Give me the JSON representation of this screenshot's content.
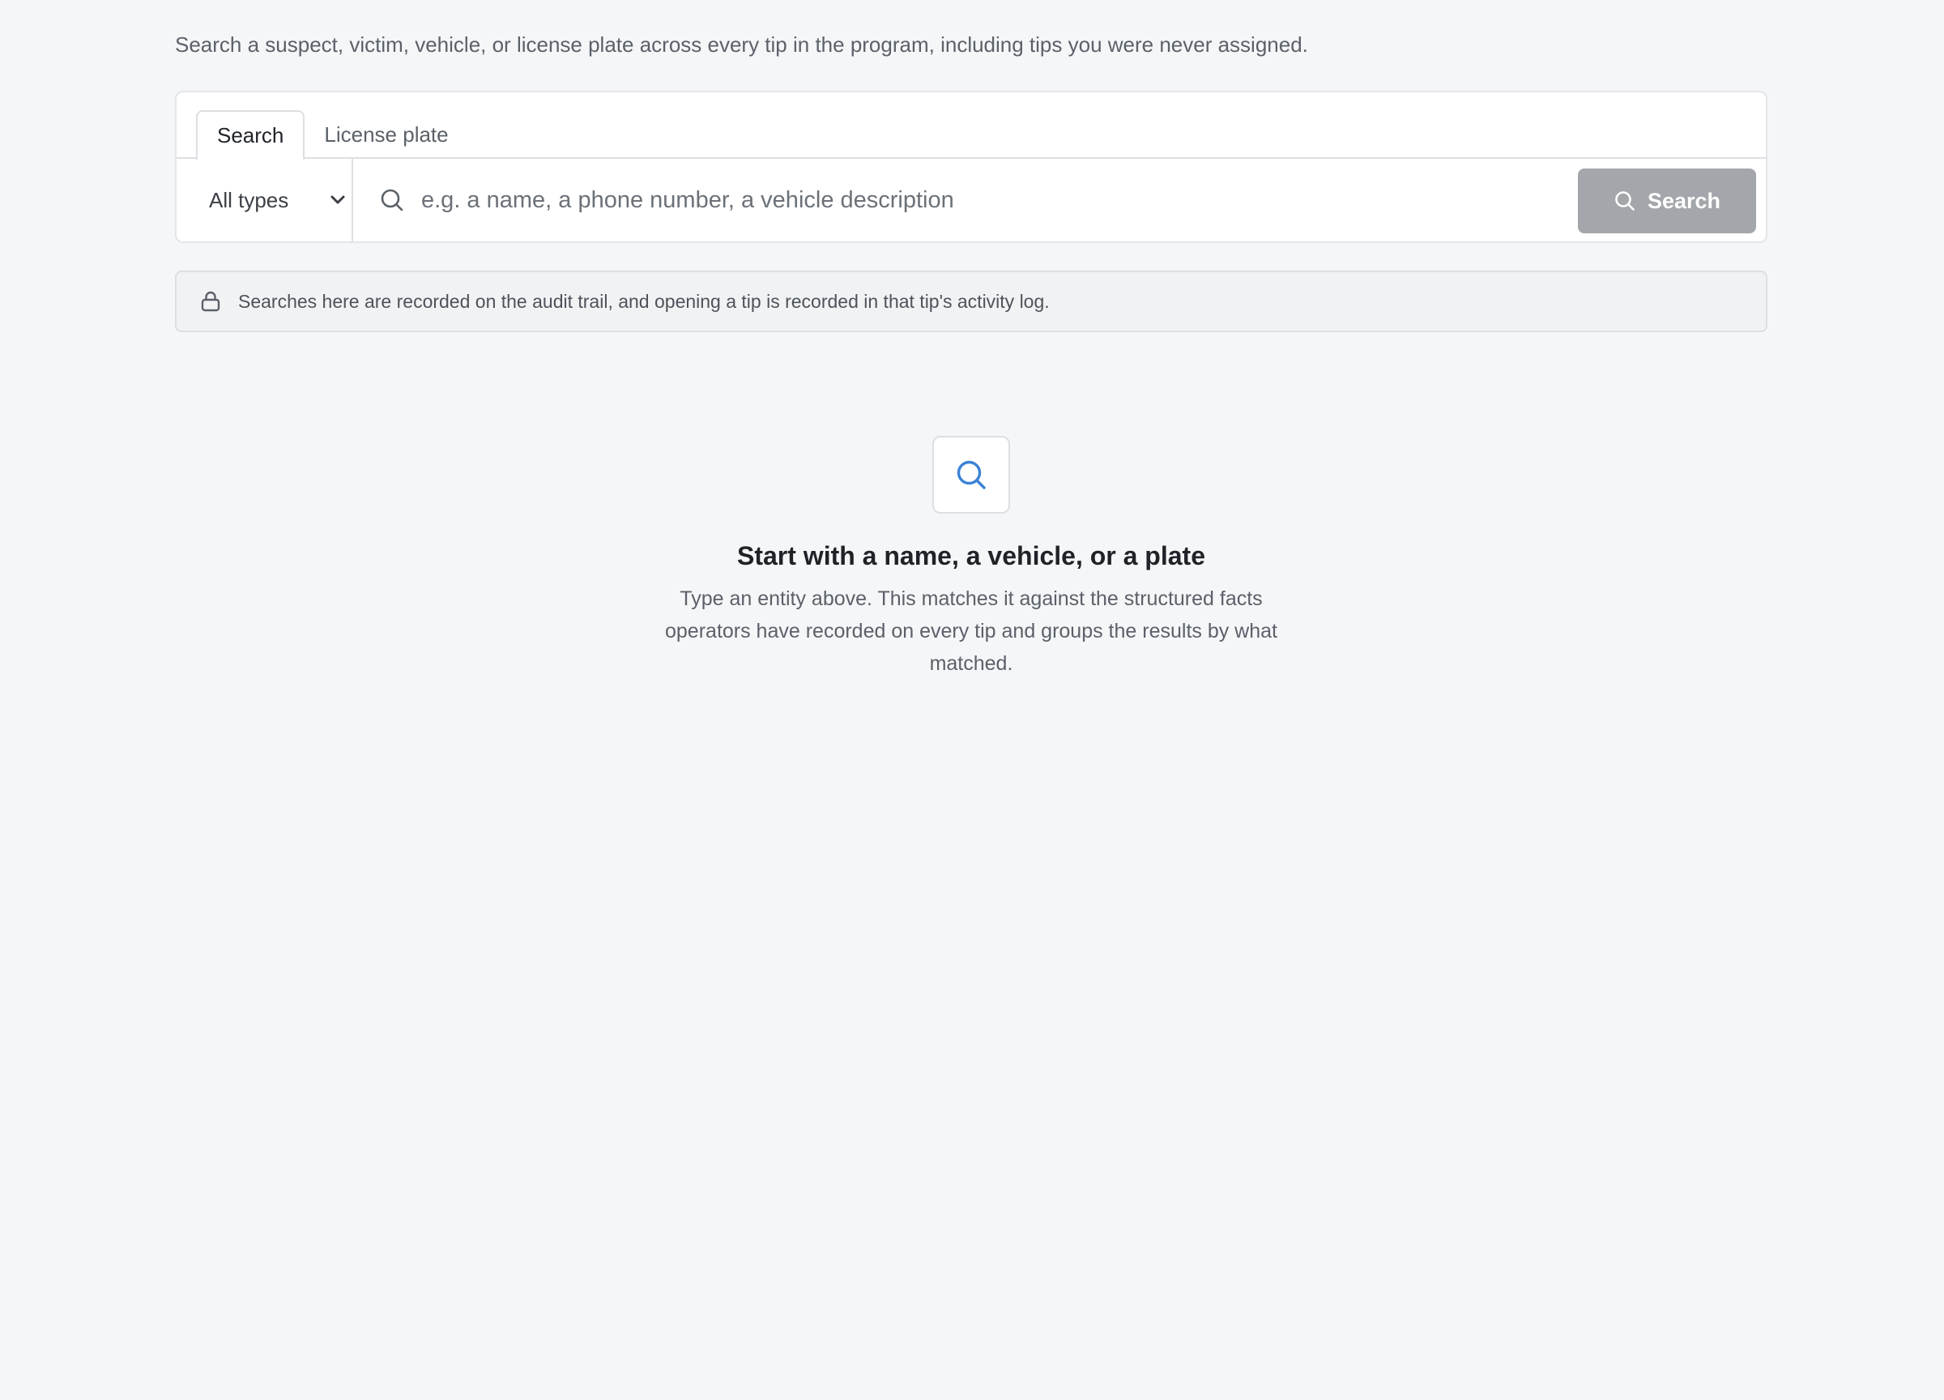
{
  "intro": "Search a suspect, victim, vehicle, or license plate across every tip in the program, including tips you were never assigned.",
  "tabs": [
    {
      "label": "Search",
      "active": true
    },
    {
      "label": "License plate",
      "active": false
    }
  ],
  "search": {
    "type_selected": "All types",
    "placeholder": "e.g. a name, a phone number, a vehicle description",
    "value": "",
    "button_label": "Search",
    "button_state": "disabled"
  },
  "notice": {
    "icon": "lock-icon",
    "text": "Searches here are recorded on the audit trail, and opening a tip is recorded in that tip's activity log."
  },
  "empty_state": {
    "icon": "search-icon",
    "title": "Start with a name, a vehicle, or a plate",
    "description": "Type an entity above. This matches it against the structured facts operators have recorded on every tip and groups the results by what matched."
  },
  "colors": {
    "background": "#f5f6f8",
    "accent_icon": "#3b82d6",
    "button_disabled": "#a3a6aa"
  }
}
